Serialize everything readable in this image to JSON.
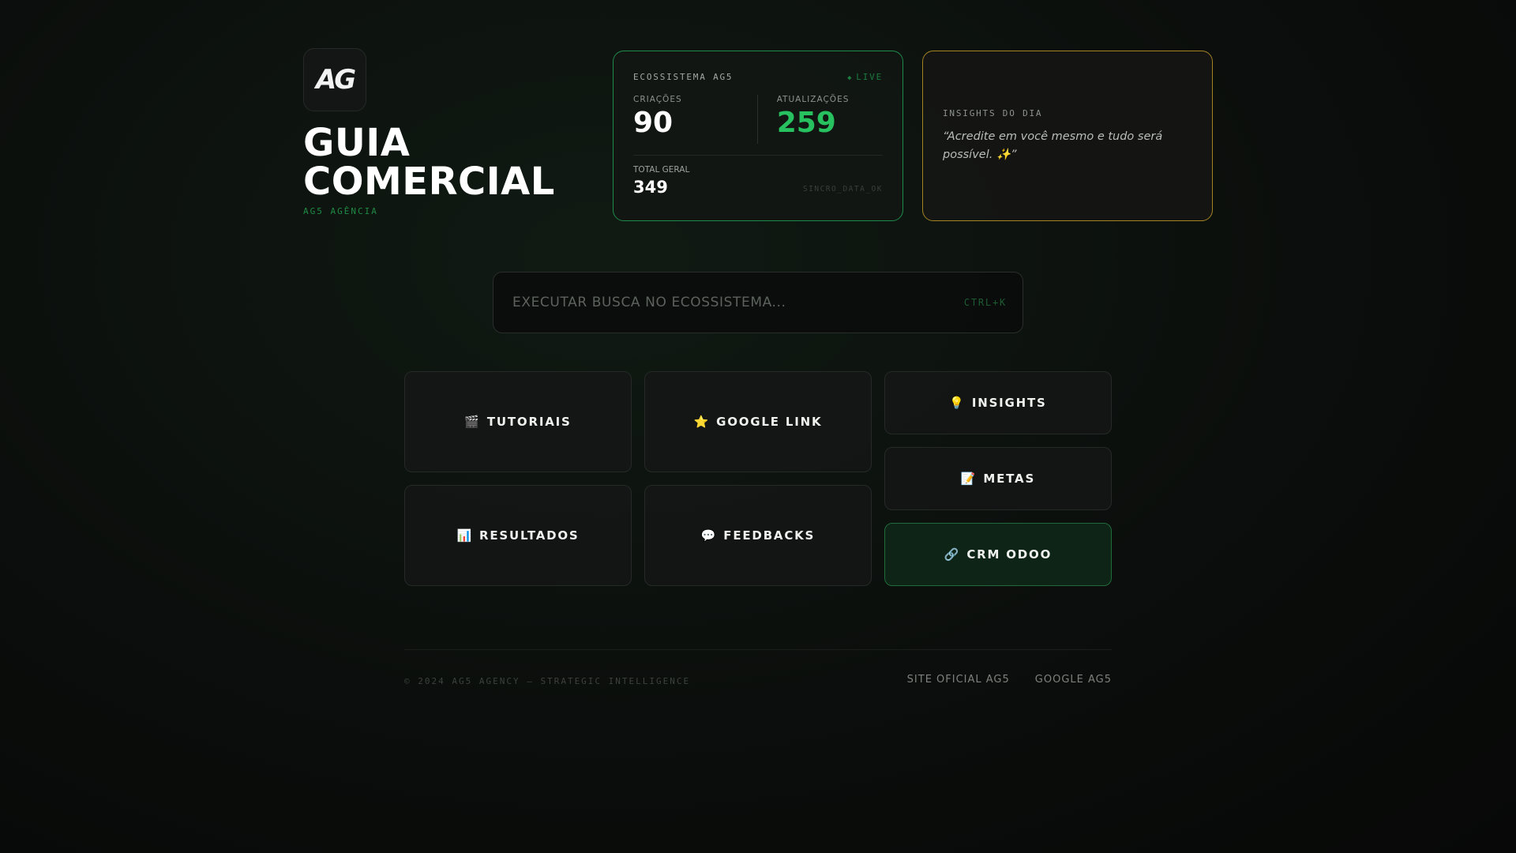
{
  "brand": {
    "logo_text": "AG",
    "title_line1": "GUIA",
    "title_line2": "COMERCIAL",
    "subtitle": "AG5 AGÊNCIA"
  },
  "stats": {
    "label": "ECOSSISTEMA AG5",
    "live": "LIVE",
    "creations_label": "CRIAÇÕES",
    "creations_value": "90",
    "updates_label": "ATUALIZAÇÕES",
    "updates_value": "259",
    "total_label": "TOTAL GERAL",
    "total_value": "349",
    "sync_status": "SINCRO_DATA_OK"
  },
  "insights": {
    "label": "INSIGHTS DO DIA",
    "quote": "“Acredite em você mesmo e tudo será possível. ✨”"
  },
  "search": {
    "placeholder": "EXECUTAR BUSCA NO ECOSSISTEMA...",
    "shortcut": "CTRL+K"
  },
  "tiles": [
    {
      "icon": "🎬",
      "label": "TUTORIAIS"
    },
    {
      "icon": "⭐",
      "label": "GOOGLE LINK"
    },
    {
      "icon": "📊",
      "label": "RESULTADOS"
    },
    {
      "icon": "💬",
      "label": "FEEDBACKS"
    },
    {
      "icon": "💡",
      "label": "INSIGHTS"
    },
    {
      "icon": "📝",
      "label": "METAS"
    },
    {
      "icon": "🔗",
      "label": "CRM ODOO"
    }
  ],
  "footer": {
    "copyright": "© 2024 AG5 AGENCY — STRATEGIC INTELLIGENCE",
    "links": [
      "SITE OFICIAL AG5",
      "GOOGLE AG5"
    ]
  },
  "colors": {
    "accent_green": "#27c25f",
    "stats_border": "#1f8a4a",
    "insights_border": "#a38322",
    "crm_background": "#0e2416"
  }
}
